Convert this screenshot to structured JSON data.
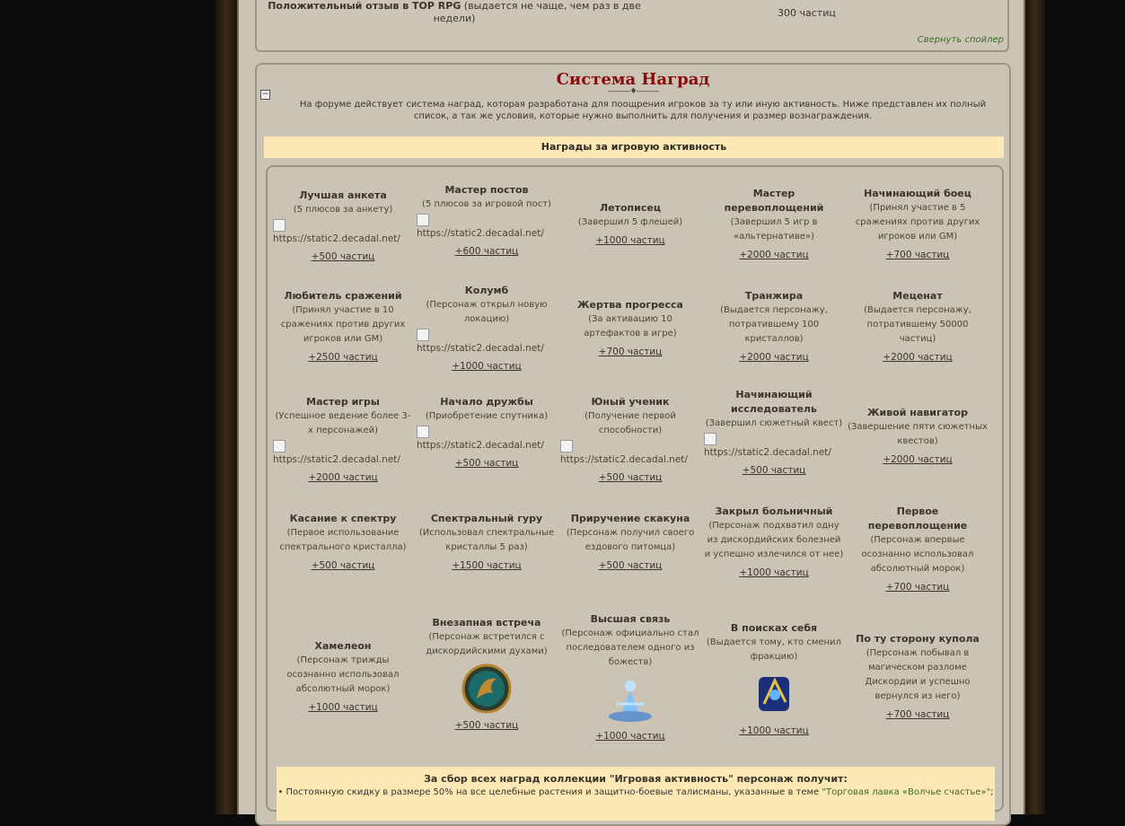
{
  "top_reward": {
    "label_bold": "Положительный отзыв в TOP RPG",
    "label_rest": "(выдается не чаще, чем раз в две недели)",
    "value": "300 частиц",
    "collapse_link": "Свернуть спойлер"
  },
  "section": {
    "toggle_symbol": "−",
    "title": "Система Наград",
    "divider": "-----------♦-----------",
    "intro": "На форуме действует система наград, которая разработана для поощрения игроков за ту или иную активность. Ниже представлен их полный список, а так же условия, которые нужно выполнить для получения и размер вознаграждения.",
    "subsection_title": "Награды за игровую активность"
  },
  "image_url_text": "https://static2.decadal.net/",
  "awards": [
    {
      "name": "Лучшая анкета",
      "cond": "(5 плюсов за анкету)",
      "reward": "+500 частиц"
    },
    {
      "name": "Мастер постов",
      "cond": "(5 плюсов за игровой пост)",
      "reward": "+600 частиц"
    },
    {
      "name": "Летописец",
      "cond": "(Завершил 5 флешей)",
      "reward": "+1000 частиц"
    },
    {
      "name": "Мастер перевоплощений",
      "cond": "(Завершил 5 игр в «альтернативе»)",
      "reward": "+2000 частиц"
    },
    {
      "name": "Начинающий боец",
      "cond": "(Принял участие в 5 сражениях против других игроков или GM)",
      "reward": "+700 частиц"
    },
    {
      "name": "Любитель сражений",
      "cond": "(Принял участие в 10 сражениях против других игроков или GM)",
      "reward": "+2500 частиц"
    },
    {
      "name": "Колумб",
      "cond": "(Персонаж открыл новую локацию)",
      "reward": "+1000 частиц"
    },
    {
      "name": "Жертва прогресса",
      "cond": "(За активацию 10 артефактов в игре)",
      "reward": "+700 частиц"
    },
    {
      "name": "Транжира",
      "cond": "(Выдается персонажу, потратившему 100 кристаллов)",
      "reward": "+2000 частиц"
    },
    {
      "name": "Меценат",
      "cond": "(Выдается персонажу, потратившему 50000 частиц)",
      "reward": "+2000 частиц"
    },
    {
      "name": "Мастер игры",
      "cond": "(Успешное ведение более 3-х персонажей)",
      "reward": "+2000 частиц"
    },
    {
      "name": "Начало дружбы",
      "cond": "(Приобретение спутника)",
      "reward": "+500 частиц"
    },
    {
      "name": "Юный ученик",
      "cond": "(Получение первой способности)",
      "reward": "+500 частиц"
    },
    {
      "name": "Начинающий исследователь",
      "cond": "(Завершил сюжетный квест)",
      "reward": "+500 частиц"
    },
    {
      "name": "Живой навигатор",
      "cond": "(Завершение пяти сюжетных квестов)",
      "reward": "+2000 частиц"
    },
    {
      "name": "Касание к спектру",
      "cond": "(Первое использование спектрального кристалла)",
      "reward": "+500 частиц"
    },
    {
      "name": "Спектральный гуру",
      "cond": "(Использовал спектральные кристаллы 5 раз)",
      "reward": "+1500 частиц"
    },
    {
      "name": "Приручение скакуна",
      "cond": "(Персонаж получил своего ездового питомца)",
      "reward": "+500 частиц"
    },
    {
      "name": "Закрыл больничный",
      "cond": "(Персонаж подхватил одну из дискордийских болезней и успешно излечился от нее)",
      "reward": "+1000 частиц"
    },
    {
      "name": "Первое перевоплощение",
      "cond": "(Персонаж впервые осознанно использовал абсолютный морок)",
      "reward": "+700 частиц"
    },
    {
      "name": "Хамелеон",
      "cond": "(Персонаж трижды осознанно использовал абсолютный морок)",
      "reward": "+1000 частиц"
    },
    {
      "name": "Внезапная встреча",
      "cond": "(Персонаж встретился с дискордийскими духами)",
      "reward": "+500 частиц"
    },
    {
      "name": "Высшая связь",
      "cond": "(Персонаж официально стал последователем одного из божеств)",
      "reward": "+1000 частиц"
    },
    {
      "name": "В поисках себя",
      "cond": "(Выдается тому, кто сменил фракцию)",
      "reward": "+1000 частиц"
    },
    {
      "name": "По ту сторону купола",
      "cond": "(Персонаж побывал в магическом разломе Дискордии и успешно вернулся из него)",
      "reward": "+700 частиц"
    }
  ],
  "collection": {
    "title": "За сбор всех наград коллекции \"Игровая активность\" персонаж получит:",
    "bullet": "• Постоянную скидку в размере 50% на все целебные растения и защитно-боевые талисманы, указанные в теме",
    "link_text": "\"Торговая лавка «Волчье счастье»\"",
    "tail": ";"
  },
  "colors": {
    "title_red": "#8a0d0d",
    "section_yellow": "#fbe8b5",
    "link_green": "#3d6b24",
    "page_bg": "#cbc4b6"
  }
}
